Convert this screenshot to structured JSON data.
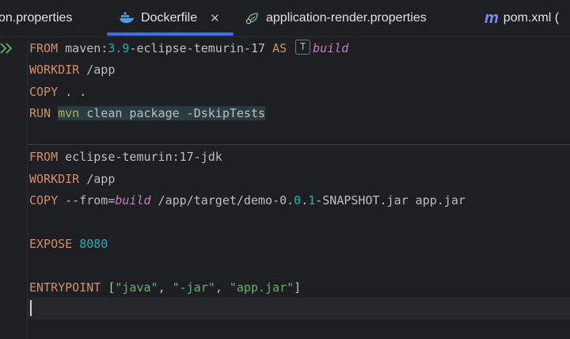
{
  "tabs": [
    {
      "label": "on.properties",
      "icon": "properties-file-icon",
      "active": false
    },
    {
      "label": "Dockerfile",
      "icon": "docker-icon",
      "active": true
    },
    {
      "label": "application-render.properties",
      "icon": "spring-leaf-icon",
      "active": false
    },
    {
      "label": "pom.xml (",
      "icon": "maven-icon",
      "active": false
    }
  ],
  "tab_icons": {
    "maven_glyph": "m"
  },
  "close_glyph": "✕",
  "colors": {
    "background": "#1e1f22",
    "keyword": "#cf8e6d",
    "number": "#2aacb8",
    "string": "#6aab73",
    "variable": "#c77dbb",
    "accent": "#3574f0"
  },
  "code": {
    "l1": {
      "kw1": "FROM",
      "t1": " maven:",
      "n1": "3.9",
      "t2": "-eclipse-temurin-17 ",
      "kw2": "AS",
      "badge": "T",
      "v1": "build"
    },
    "l2": {
      "kw": "WORKDIR",
      "t": " /app"
    },
    "l3": {
      "kw": "COPY",
      "t": " . ."
    },
    "l4": {
      "kw": "RUN",
      "mvn": "mvn",
      "t": " clean package -DskipTests"
    },
    "l5": {
      "kw": "FROM",
      "t": " eclipse-temurin:17-jdk"
    },
    "l6": {
      "kw": "WORKDIR",
      "t": " /app"
    },
    "l7": {
      "kw": "COPY",
      "t1": " --from=",
      "v": "build",
      "t2": " /app/target/demo-0.",
      "n1": "0",
      "t3": ".",
      "n2": "1",
      "t4": "-SNAPSHOT.jar app.jar"
    },
    "l8": {
      "kw": "EXPOSE",
      "n": "8080"
    },
    "l9": {
      "kw": "ENTRYPOINT",
      "t1": " [",
      "s1": "\"java\"",
      "t2": ", ",
      "s2": "\"-jar\"",
      "t3": ", ",
      "s3": "\"app.jar\"",
      "t4": "]"
    }
  }
}
